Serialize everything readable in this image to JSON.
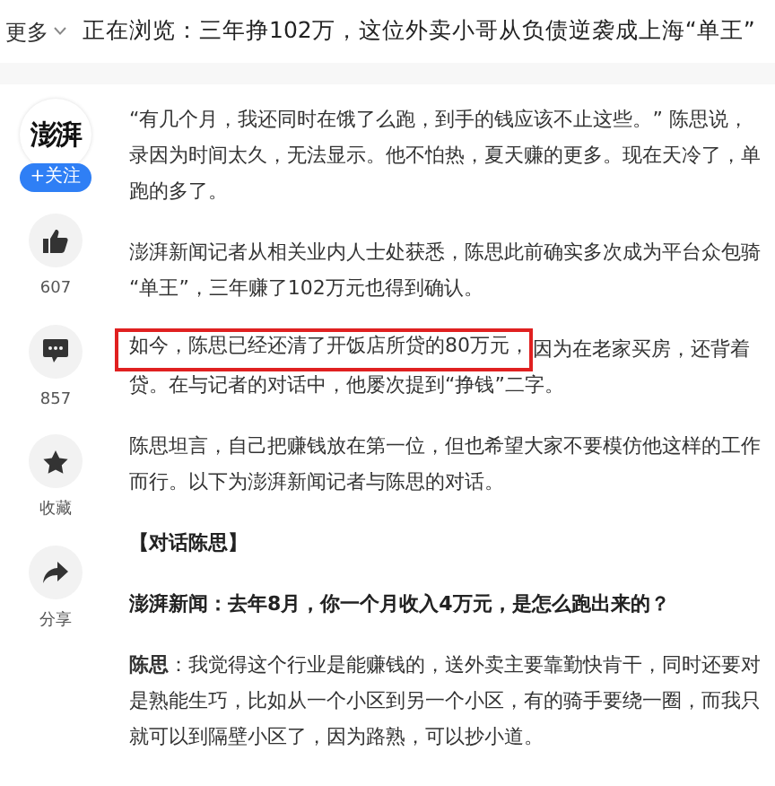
{
  "top_bar": {
    "more_menu": "更多",
    "now_browsing": "正在浏览：三年挣102万，这位外卖小哥从负债逆袭成上海“单王”"
  },
  "sidebar": {
    "logo": "澎湃",
    "follow_button": "+关注",
    "actions": [
      {
        "kind": "like",
        "label": "607"
      },
      {
        "kind": "comment",
        "label": "857"
      },
      {
        "kind": "star",
        "label": "收藏"
      },
      {
        "kind": "share",
        "label": "分享"
      }
    ]
  },
  "article": {
    "paragraphs": [
      {
        "kind": "text",
        "lines": [
          {
            "text": "“有几个月，我还同时在饿了么跑，到手的钱应该不止这些。” 陈思说，"
          },
          {
            "text": "录因为时间太久，无法显示。他不怕热，夏天赚的更多。现在天冷了，单"
          },
          {
            "text": "跑的多了。"
          }
        ]
      },
      {
        "kind": "text",
        "lines": [
          {
            "text": "澎湃新闻记者从相关业内人士处获悉，陈思此前确实多次成为平台众包骑"
          },
          {
            "text": "“单王”，三年赚了102万元也得到确认。"
          }
        ]
      },
      {
        "kind": "text",
        "lines": [
          {
            "highlighted": "如今，陈思已经还清了开饭店所贷的80万元，",
            "text": "因为在老家买房，还背着"
          },
          {
            "text": "贷。在与记者的对话中，他屡次提到“挣钱”二字。"
          }
        ]
      },
      {
        "kind": "text",
        "lines": [
          {
            "text": "陈思坦言，自己把赚钱放在第一位，但也希望大家不要模仿他这样的工作"
          },
          {
            "text": "而行。以下为澎湃新闻记者与陈思的对话。"
          }
        ]
      },
      {
        "kind": "heading",
        "lines": [
          {
            "text": "【对话陈思】"
          }
        ]
      },
      {
        "kind": "question",
        "lines": [
          {
            "text": "澎湃新闻：去年8月，你一个月收入4万元，是怎么跑出来的？"
          }
        ]
      },
      {
        "kind": "answer",
        "lines": [
          {
            "text": "**陈思**：我觉得这个行业是能赚钱的，送外卖主要靠勤快肯干，同时还要对"
          },
          {
            "text": "是熟能生巧，比如从一个小区到另一个小区，有的骑手要绕一圈，而我只"
          },
          {
            "text": "就可以到隔壁小区了，因为路熟，可以抄小道。"
          }
        ]
      }
    ]
  }
}
